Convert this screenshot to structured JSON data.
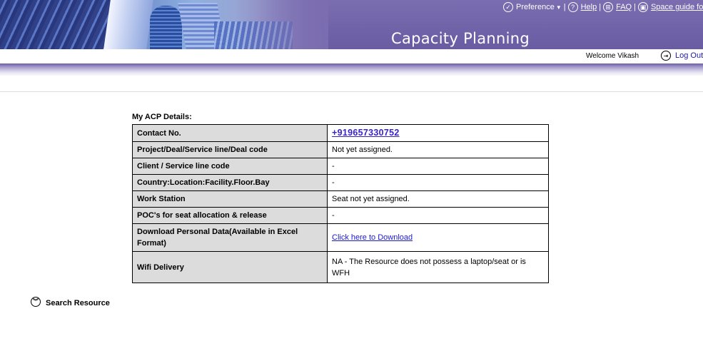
{
  "header": {
    "app_title": "Capacity Planning",
    "nav_links": {
      "preference": "Preference",
      "help": "Help",
      "faq": "FAQ",
      "space_guide": "Space guide fo"
    },
    "welcome_text": "Welcome Vikash",
    "logout_label": "Log Out"
  },
  "details": {
    "section_title": "My ACP Details:",
    "rows": [
      {
        "label": "Contact No.",
        "value": "+919657330752"
      },
      {
        "label": "Project/Deal/Service line/Deal code",
        "value": "Not yet assigned."
      },
      {
        "label": "Client / Service line code",
        "value": "-"
      },
      {
        "label": "Country:Location:Facility.Floor.Bay",
        "value": "-"
      },
      {
        "label": "Work Station",
        "value": "Seat not yet assigned."
      },
      {
        "label": "POC's for seat allocation & release",
        "value": "-"
      },
      {
        "label": "Download Personal Data(Available in Excel Format)",
        "value": "Click here to Download"
      },
      {
        "label": "Wifi Delivery",
        "value": "NA - The Resource does not possess a laptop/seat or is WFH"
      }
    ]
  },
  "search_resource": {
    "label": "Search Resource"
  },
  "colors": {
    "header_purple": "#6a5ca3",
    "link_blue": "#1a1acc",
    "phone_link": "#3a22c8",
    "label_cell_bg": "#dcdcdc"
  },
  "icons": [
    "check-circle-icon",
    "help-icon",
    "faq-icon",
    "space-guide-icon",
    "logout-icon",
    "expand-chevron-icon"
  ]
}
